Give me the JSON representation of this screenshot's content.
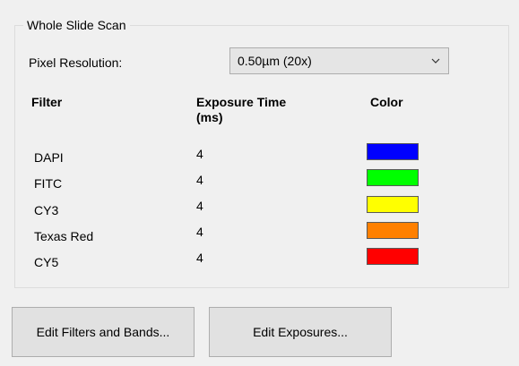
{
  "group_title": "Whole Slide Scan",
  "pixel_resolution": {
    "label": "Pixel Resolution:",
    "selected": "0.50µm (20x)"
  },
  "table": {
    "headers": {
      "filter": "Filter",
      "exposure_line1": "Exposure Time",
      "exposure_line2": "(ms)",
      "color": "Color"
    },
    "rows": [
      {
        "filter": "DAPI",
        "exposure": "4",
        "color": "#0000ff"
      },
      {
        "filter": "FITC",
        "exposure": "4",
        "color": "#00ff00"
      },
      {
        "filter": "CY3",
        "exposure": "4",
        "color": "#ffff00"
      },
      {
        "filter": "Texas Red",
        "exposure": "4",
        "color": "#ff8000"
      },
      {
        "filter": "CY5",
        "exposure": "4",
        "color": "#ff0000"
      }
    ]
  },
  "buttons": {
    "edit_filters": "Edit Filters and Bands...",
    "edit_exposures": "Edit Exposures..."
  }
}
